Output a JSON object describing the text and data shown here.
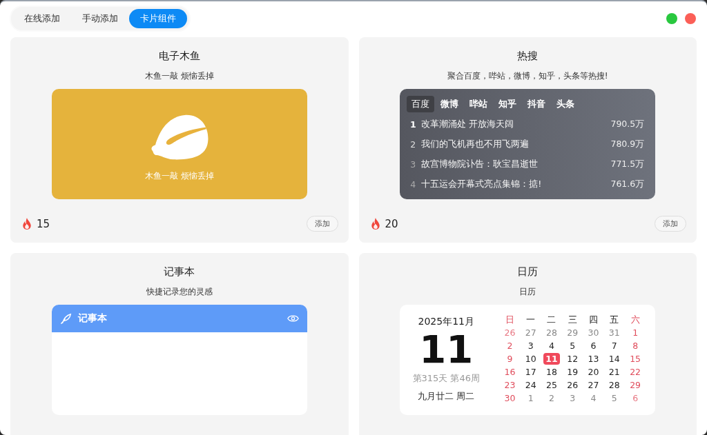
{
  "tabs": [
    {
      "label": "在线添加",
      "selected": false
    },
    {
      "label": "手动添加",
      "selected": false
    },
    {
      "label": "卡片组件",
      "selected": true
    }
  ],
  "cards": [
    {
      "kind": "muyu",
      "title": "电子木鱼",
      "subtitle": "木鱼一敲 烦恼丢掉",
      "caption": "木鱼一敲 烦恼丢掉",
      "footer": {
        "count": "15",
        "button": "添加"
      }
    },
    {
      "kind": "hot",
      "title": "热搜",
      "subtitle": "聚合百度，哔站，微博，知乎，头条等热搜!",
      "sources": [
        {
          "label": "百度",
          "selected": true
        },
        {
          "label": "微博",
          "selected": false
        },
        {
          "label": "哔站",
          "selected": false
        },
        {
          "label": "知乎",
          "selected": false
        },
        {
          "label": "抖音",
          "selected": false
        },
        {
          "label": "头条",
          "selected": false
        }
      ],
      "items": [
        {
          "rank": "1",
          "title": "改革潮涌处 开放海天阔",
          "heat": "790.5万"
        },
        {
          "rank": "2",
          "title": "我们的飞机再也不用飞两遍",
          "heat": "780.9万"
        },
        {
          "rank": "3",
          "title": "故宫博物院讣告：耿宝昌逝世",
          "heat": "771.5万"
        },
        {
          "rank": "4",
          "title": "十五运会开幕式亮点集锦：掂!",
          "heat": "761.6万"
        }
      ],
      "footer": {
        "count": "20",
        "button": "添加"
      }
    },
    {
      "kind": "notes",
      "title": "记事本",
      "subtitle": "快捷记录您的灵感",
      "header": "记事本"
    },
    {
      "kind": "calendar",
      "title": "日历",
      "subtitle": "日历",
      "month": "2025年11月",
      "day": "11",
      "info": "第315天 第46周",
      "lunar": "九月廿二 周二",
      "weekdays": [
        "日",
        "一",
        "二",
        "三",
        "四",
        "五",
        "六"
      ],
      "weeks": [
        [
          {
            "d": "26",
            "outside": true,
            "selected": false
          },
          {
            "d": "27",
            "outside": true,
            "selected": false
          },
          {
            "d": "28",
            "outside": true,
            "selected": false
          },
          {
            "d": "29",
            "outside": true,
            "selected": false
          },
          {
            "d": "30",
            "outside": true,
            "selected": false
          },
          {
            "d": "31",
            "outside": true,
            "selected": false
          },
          {
            "d": "1",
            "outside": false,
            "selected": false
          }
        ],
        [
          {
            "d": "2",
            "outside": false,
            "selected": false
          },
          {
            "d": "3",
            "outside": false,
            "selected": false
          },
          {
            "d": "4",
            "outside": false,
            "selected": false
          },
          {
            "d": "5",
            "outside": false,
            "selected": false
          },
          {
            "d": "6",
            "outside": false,
            "selected": false
          },
          {
            "d": "7",
            "outside": false,
            "selected": false
          },
          {
            "d": "8",
            "outside": false,
            "selected": false
          }
        ],
        [
          {
            "d": "9",
            "outside": false,
            "selected": false
          },
          {
            "d": "10",
            "outside": false,
            "selected": false
          },
          {
            "d": "11",
            "outside": false,
            "selected": true
          },
          {
            "d": "12",
            "outside": false,
            "selected": false
          },
          {
            "d": "13",
            "outside": false,
            "selected": false
          },
          {
            "d": "14",
            "outside": false,
            "selected": false
          },
          {
            "d": "15",
            "outside": false,
            "selected": false
          }
        ],
        [
          {
            "d": "16",
            "outside": false,
            "selected": false
          },
          {
            "d": "17",
            "outside": false,
            "selected": false
          },
          {
            "d": "18",
            "outside": false,
            "selected": false
          },
          {
            "d": "19",
            "outside": false,
            "selected": false
          },
          {
            "d": "20",
            "outside": false,
            "selected": false
          },
          {
            "d": "21",
            "outside": false,
            "selected": false
          },
          {
            "d": "22",
            "outside": false,
            "selected": false
          }
        ],
        [
          {
            "d": "23",
            "outside": false,
            "selected": false
          },
          {
            "d": "24",
            "outside": false,
            "selected": false
          },
          {
            "d": "25",
            "outside": false,
            "selected": false
          },
          {
            "d": "26",
            "outside": false,
            "selected": false
          },
          {
            "d": "27",
            "outside": false,
            "selected": false
          },
          {
            "d": "28",
            "outside": false,
            "selected": false
          },
          {
            "d": "29",
            "outside": false,
            "selected": false
          }
        ],
        [
          {
            "d": "30",
            "outside": false,
            "selected": false
          },
          {
            "d": "1",
            "outside": true,
            "selected": false
          },
          {
            "d": "2",
            "outside": true,
            "selected": false
          },
          {
            "d": "3",
            "outside": true,
            "selected": false
          },
          {
            "d": "4",
            "outside": true,
            "selected": false
          },
          {
            "d": "5",
            "outside": true,
            "selected": false
          },
          {
            "d": "6",
            "outside": true,
            "selected": false
          }
        ]
      ]
    }
  ]
}
